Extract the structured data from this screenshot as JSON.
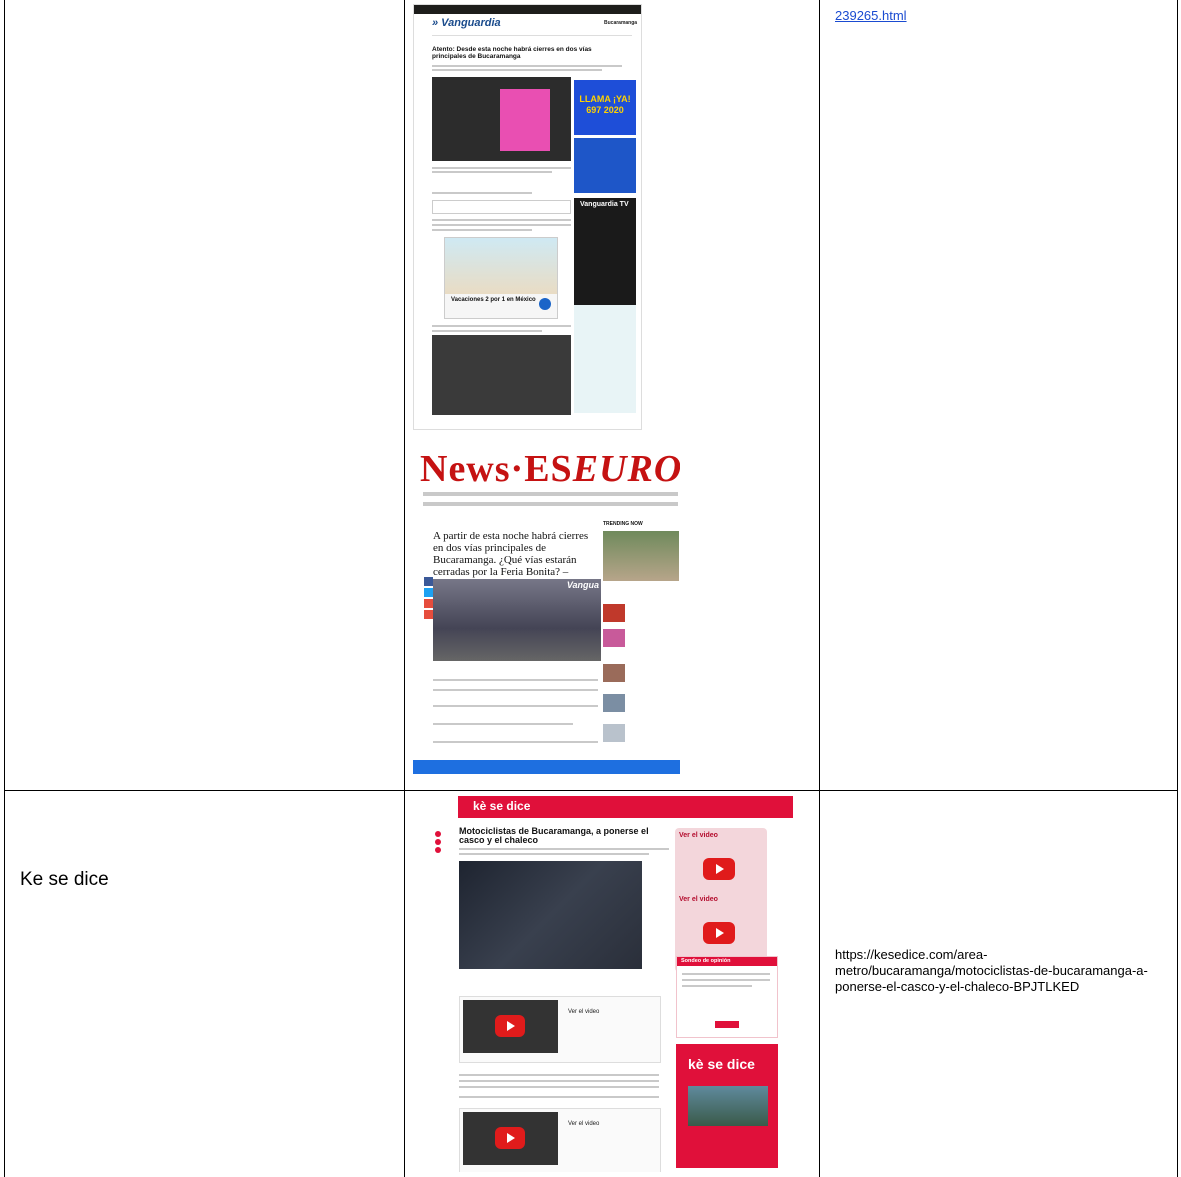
{
  "row1": {
    "source_name": "",
    "url_fragment": "239265.html",
    "vanguardia": {
      "logo": "» Vanguardia",
      "city": "Bucaramanga",
      "headline": "Atento: Desde esta noche habrá cierres en dos vías principales de Bucaramanga",
      "call_ad": "LLAMA ¡YA! 697 2020",
      "tv_label": "Vanguardia TV",
      "beach_ad": "Vacaciones 2 por 1 en México"
    },
    "newseseuro": {
      "brand_a": "News·ES",
      "brand_b": "EURO",
      "headline": "A partir de esta noche habrá cierres en dos vías principales de Bucaramanga. ¿Qué vías estarán cerradas por la Feria Bonita? –",
      "trending": "TRENDING NOW",
      "photo_tag": "Vangua"
    }
  },
  "row2": {
    "source_name": "Ke se dice",
    "url": "https://kesedice.com/area-metro/bucaramanga/motociclistas-de-bucaramanga-a-ponerse-el-casco-y-el-chaleco-BPJTLKED",
    "kesedice": {
      "logo": "kè se dice",
      "headline": "Motociclistas de Bucaramanga, a ponerse el casco y el chaleco",
      "video_label": "Ver el video",
      "poll_title": "Sondeo de opinión",
      "promo_logo": "kè se dice"
    }
  },
  "colors": {
    "border": "#000000",
    "link": "#1a4bd1",
    "kesedice_red": "#e0103a",
    "newseseuro_red": "#c51212"
  }
}
